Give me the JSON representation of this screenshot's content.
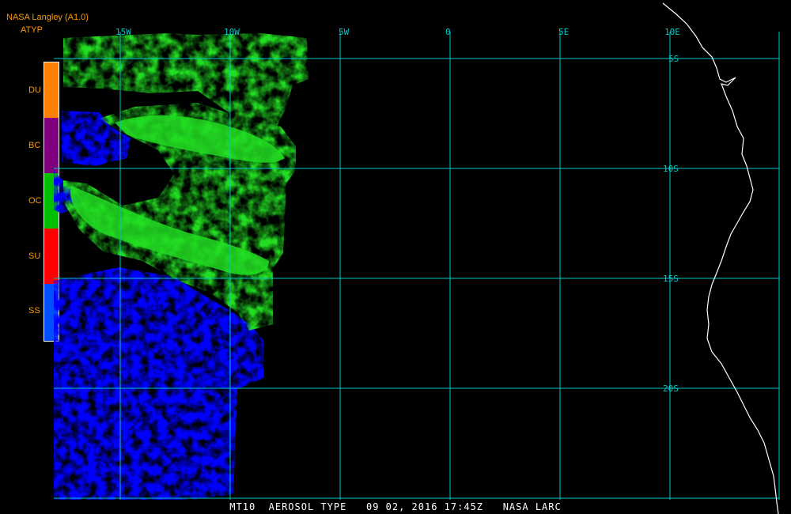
{
  "header": {
    "title": "NASA Langley (A1.0)",
    "product": "ATYP"
  },
  "legend": [
    {
      "code": "DU",
      "color": "#ff8000"
    },
    {
      "code": "BC",
      "color": "#800080"
    },
    {
      "code": "OC",
      "color": "#00c000"
    },
    {
      "code": "SU",
      "color": "#ff0000"
    },
    {
      "code": "SS",
      "color": "#0050ff"
    }
  ],
  "grid": {
    "lon_labels": [
      "15W",
      "10W",
      "5W",
      "0",
      "5E",
      "10E"
    ],
    "lat_labels": [
      "5S",
      "10S",
      "15S",
      "20S"
    ],
    "color": "#00c8c8"
  },
  "footer": "MT10  AEROSOL TYPE   09 02, 2016 17:45Z   NASA LARC",
  "colors": {
    "background": "#000000",
    "coast": "#ffffff",
    "oc_plume": "#22dd22",
    "ss_pixels": "#0000ff"
  }
}
